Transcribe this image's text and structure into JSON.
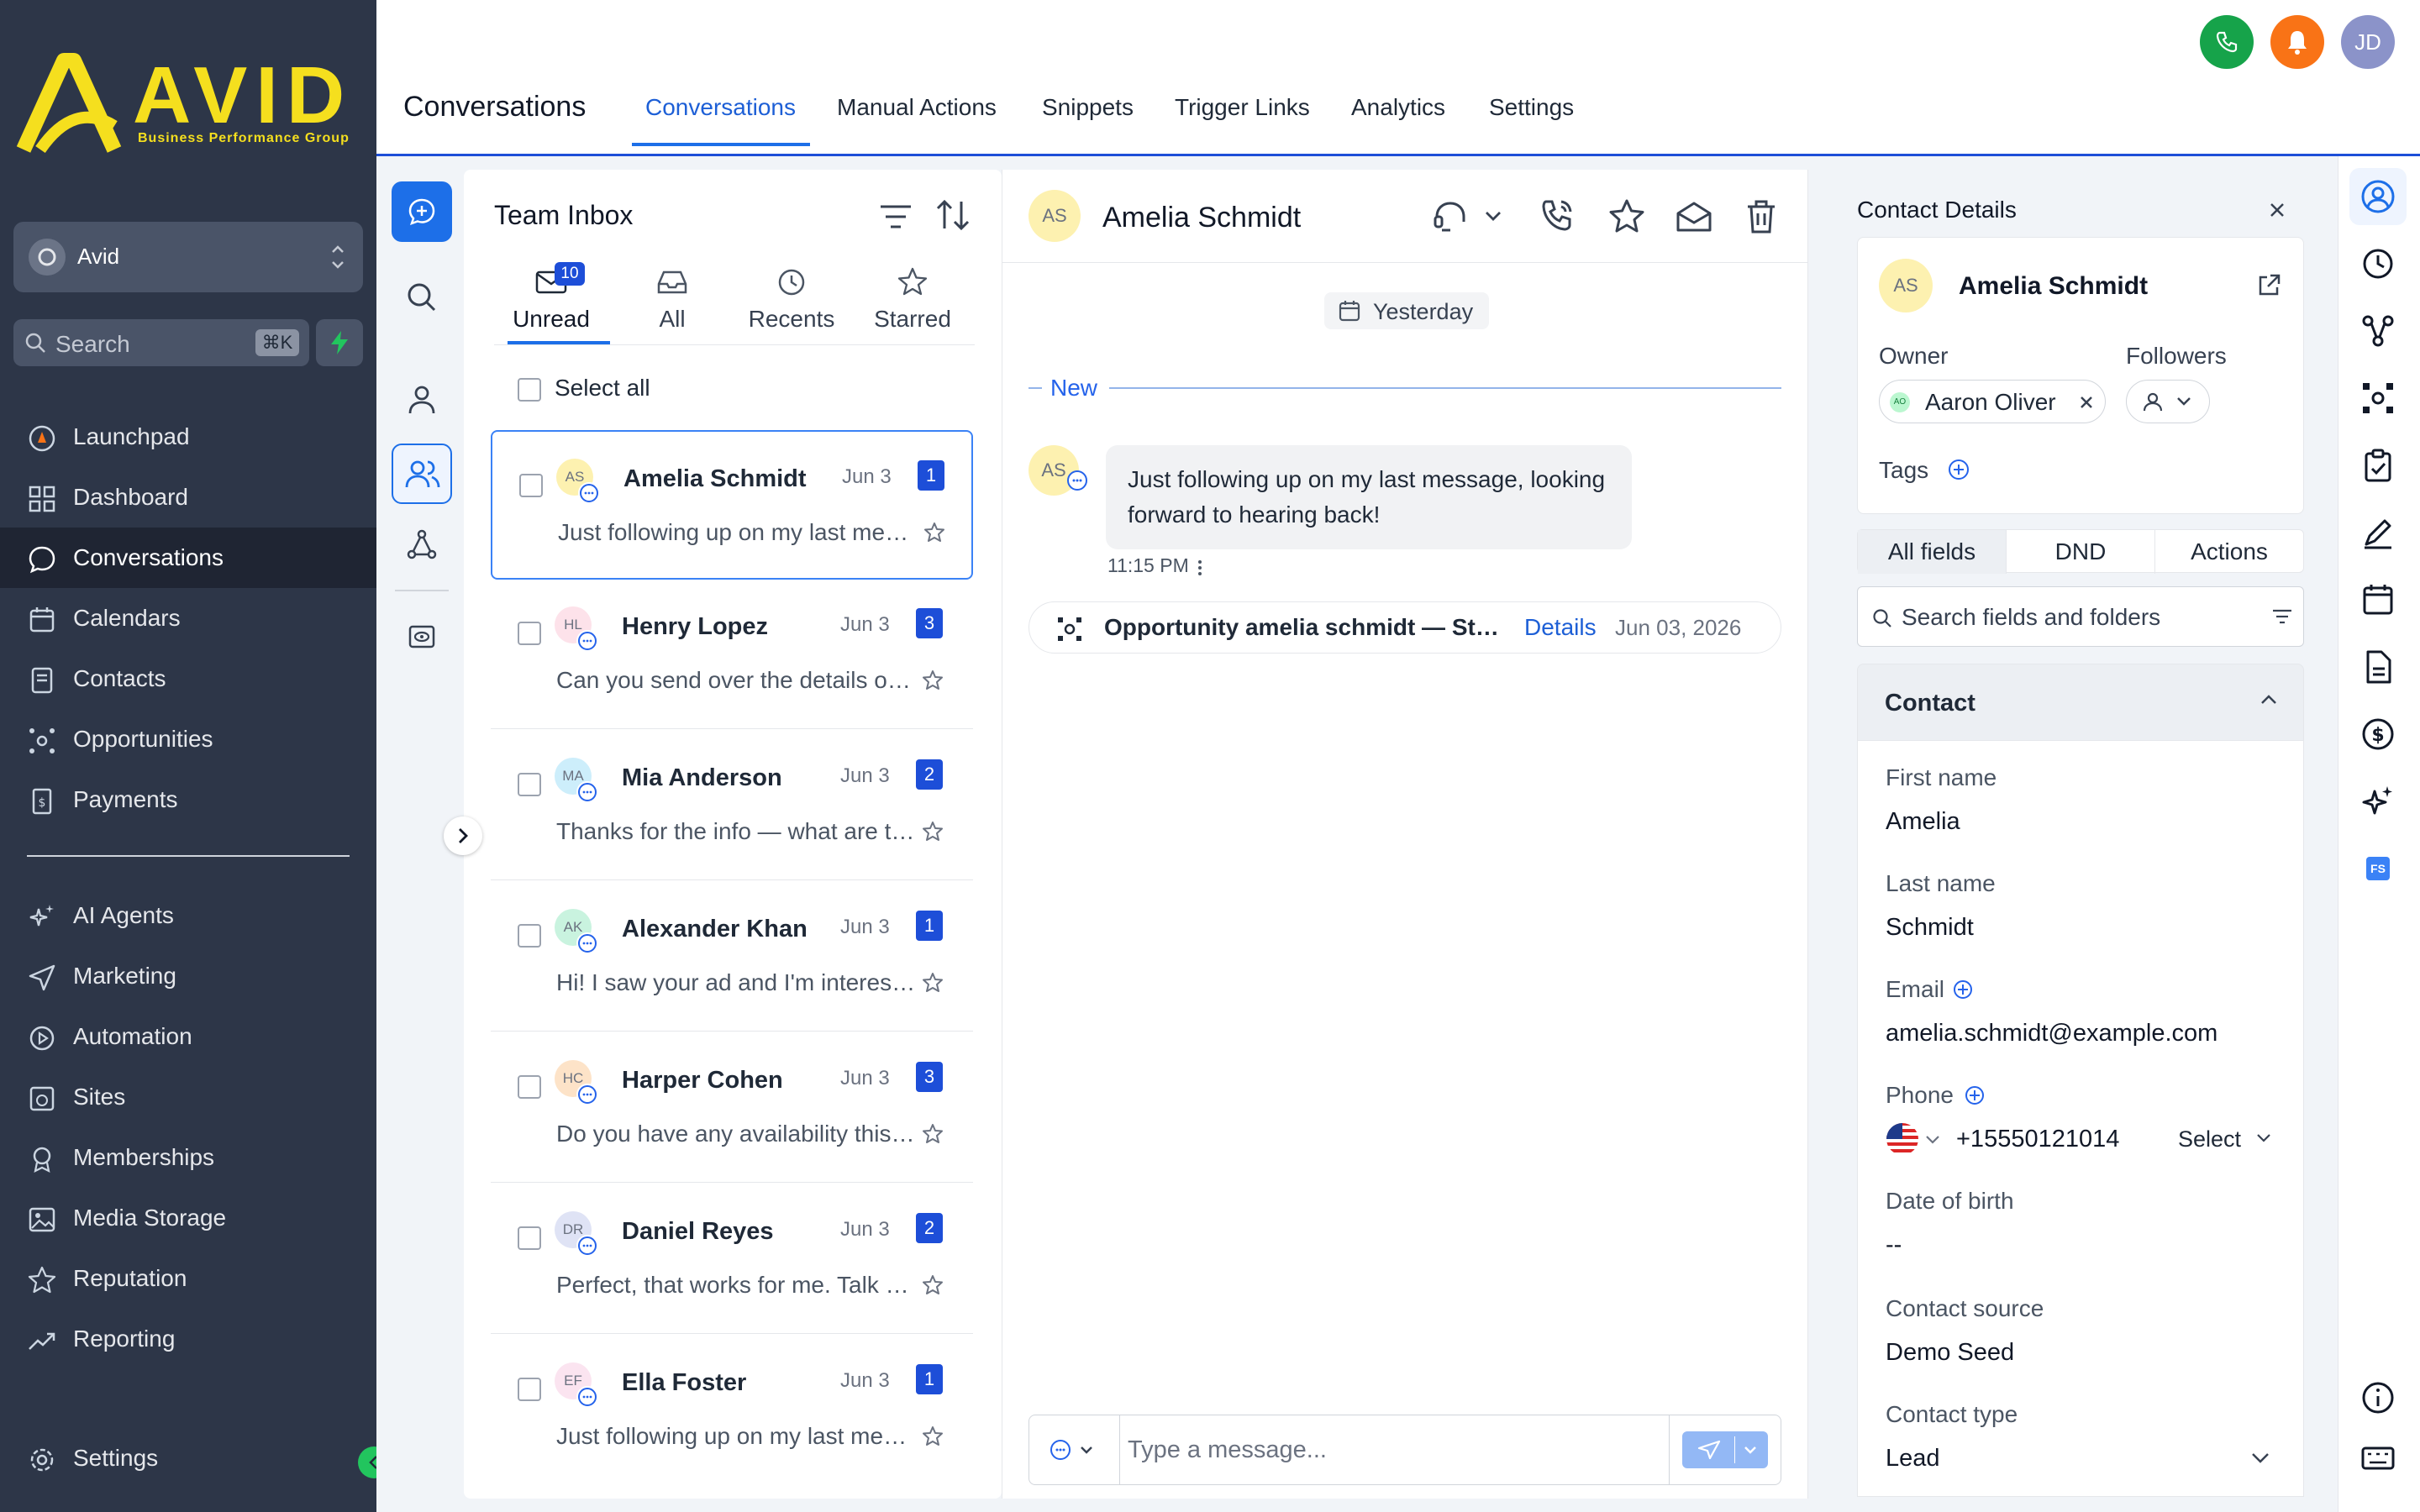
{
  "brand": {
    "name": "AVID",
    "tagline": "Business Performance Group",
    "accent": "#f5df1e"
  },
  "account": {
    "name": "Avid"
  },
  "search": {
    "placeholder": "Search",
    "shortcut": "⌘K"
  },
  "sidebar": {
    "items": [
      {
        "label": "Launchpad",
        "icon": "rocket-icon"
      },
      {
        "label": "Dashboard",
        "icon": "grid-icon"
      },
      {
        "label": "Conversations",
        "icon": "chat-bubble-icon",
        "active": true
      },
      {
        "label": "Calendars",
        "icon": "calendar-icon"
      },
      {
        "label": "Contacts",
        "icon": "contact-book-icon"
      },
      {
        "label": "Opportunities",
        "icon": "hub-icon"
      },
      {
        "label": "Payments",
        "icon": "receipt-icon"
      }
    ],
    "items2": [
      {
        "label": "AI Agents",
        "icon": "sparkle-icon"
      },
      {
        "label": "Marketing",
        "icon": "send-icon"
      },
      {
        "label": "Automation",
        "icon": "play-circle-icon"
      },
      {
        "label": "Sites",
        "icon": "globe-window-icon"
      },
      {
        "label": "Memberships",
        "icon": "badge-icon"
      },
      {
        "label": "Media Storage",
        "icon": "image-icon"
      },
      {
        "label": "Reputation",
        "icon": "star-icon"
      },
      {
        "label": "Reporting",
        "icon": "trend-up-icon"
      }
    ],
    "settings_label": "Settings"
  },
  "header": {
    "title": "Conversations",
    "tabs": [
      "Conversations",
      "Manual Actions",
      "Snippets",
      "Trigger Links",
      "Analytics",
      "Settings"
    ],
    "active_tab": "Conversations",
    "user_initials": "JD",
    "colors": {
      "phone": "#16a34a",
      "bell": "#f97316",
      "user": "#8b93c9"
    }
  },
  "inbox": {
    "title": "Team Inbox",
    "tabs": [
      {
        "label": "Unread",
        "badge": "10"
      },
      {
        "label": "All"
      },
      {
        "label": "Recents"
      },
      {
        "label": "Starred"
      }
    ],
    "select_all": "Select all",
    "conversations": [
      {
        "initials": "AS",
        "name": "Amelia Schmidt",
        "date": "Jun 3",
        "count": "1",
        "preview": "Just following up on my last message, looking forward to hearing back!",
        "avatar_bg": "#fdf1b0"
      },
      {
        "initials": "HL",
        "name": "Henry Lopez",
        "date": "Jun 3",
        "count": "3",
        "preview": "Can you send over the details on pricing?",
        "avatar_bg": "#fde2ea"
      },
      {
        "initials": "MA",
        "name": "Mia Anderson",
        "date": "Jun 3",
        "count": "2",
        "preview": "Thanks for the info — what are the next steps?",
        "avatar_bg": "#cdeefb"
      },
      {
        "initials": "AK",
        "name": "Alexander Khan",
        "date": "Jun 3",
        "count": "1",
        "preview": "Hi! I saw your ad and I'm interested in learning more.",
        "avatar_bg": "#c9f3df"
      },
      {
        "initials": "HC",
        "name": "Harper Cohen",
        "date": "Jun 3",
        "count": "3",
        "preview": "Do you have any availability this week?",
        "avatar_bg": "#fde3c8"
      },
      {
        "initials": "DR",
        "name": "Daniel Reyes",
        "date": "Jun 3",
        "count": "2",
        "preview": "Perfect, that works for me. Talk soon!",
        "avatar_bg": "#dfe3f5"
      },
      {
        "initials": "EF",
        "name": "Ella Foster",
        "date": "Jun 3",
        "count": "1",
        "preview": "Just following up on my last message.",
        "avatar_bg": "#fbe4f0"
      }
    ]
  },
  "chat": {
    "contact_initials": "AS",
    "contact_name": "Amelia Schmidt",
    "date_divider": "Yesterday",
    "new_label": "New",
    "message": {
      "text": "Just following up on my last message, looking forward to hearing back!",
      "time": "11:15 PM"
    },
    "opportunity": {
      "text": "Opportunity amelia schmidt — Stage updated",
      "link": "Details",
      "date": "Jun 03, 2026"
    },
    "composer_placeholder": "Type a message..."
  },
  "contact_panel": {
    "title": "Contact Details",
    "initials": "AS",
    "name": "Amelia Schmidt",
    "owner_label": "Owner",
    "owner_initials": "AO",
    "owner_name": "Aaron Oliver",
    "followers_label": "Followers",
    "tags_label": "Tags",
    "tabs": [
      "All fields",
      "DND",
      "Actions"
    ],
    "search_placeholder": "Search fields and folders",
    "section_title": "Contact",
    "fields": {
      "first_name_label": "First name",
      "first_name": "Amelia",
      "last_name_label": "Last name",
      "last_name": "Schmidt",
      "email_label": "Email",
      "email": "amelia.schmidt@example.com",
      "phone_label": "Phone",
      "phone": "+15550121014",
      "phone_type": "Select",
      "dob_label": "Date of birth",
      "dob": "--",
      "source_label": "Contact source",
      "source": "Demo Seed",
      "type_label": "Contact type",
      "type": "Lead"
    }
  },
  "right_rail": {
    "fs_badge": "FS"
  }
}
